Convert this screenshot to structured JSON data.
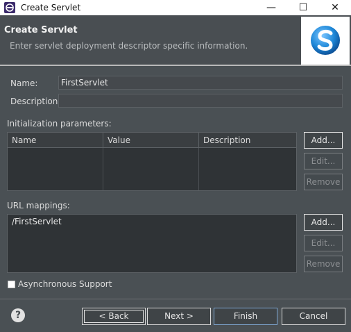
{
  "window": {
    "title": "Create Servlet",
    "min_glyph": "—",
    "max_glyph": "☐",
    "close_glyph": "✕"
  },
  "header": {
    "title": "Create Servlet",
    "subtitle": "Enter servlet deployment descriptor specific information."
  },
  "form": {
    "name_label": "Name:",
    "name_value": "FirstServlet",
    "description_label": "Description:",
    "description_value": ""
  },
  "init_params": {
    "label": "Initialization parameters:",
    "columns": [
      "Name",
      "Value",
      "Description"
    ],
    "rows": [],
    "buttons": {
      "add": "Add...",
      "edit": "Edit...",
      "remove": "Remove"
    }
  },
  "url_mappings": {
    "label": "URL mappings:",
    "items": [
      "/FirstServlet"
    ],
    "buttons": {
      "add": "Add...",
      "edit": "Edit...",
      "remove": "Remove"
    }
  },
  "async": {
    "label": "Asynchronous Support",
    "checked": false
  },
  "footer": {
    "help_glyph": "?",
    "back": "< Back",
    "next": "Next >",
    "finish": "Finish",
    "cancel": "Cancel"
  },
  "colors": {
    "background": "#4a5054",
    "table_background": "#2f3336",
    "logo_blue": "#1e88d8"
  }
}
